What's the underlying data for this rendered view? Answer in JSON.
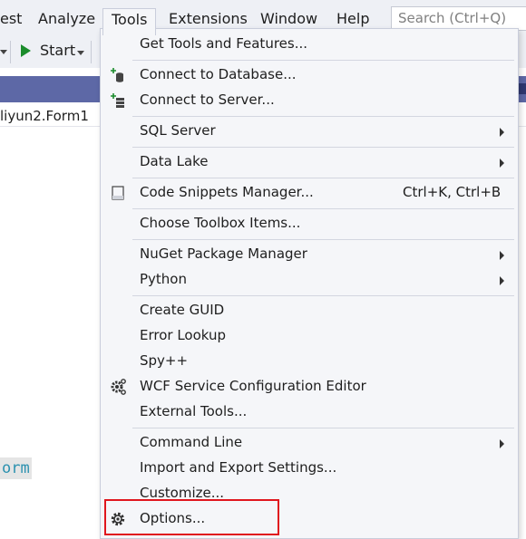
{
  "menubar": {
    "items": [
      {
        "label": "est"
      },
      {
        "label": "Analyze"
      },
      {
        "label": "Tools"
      },
      {
        "label": "Extensions"
      },
      {
        "label": "Window"
      },
      {
        "label": "Help"
      }
    ],
    "search_placeholder": "Search (Ctrl+Q)"
  },
  "toolbar": {
    "start_label": "Start"
  },
  "editor": {
    "breadcrumb": "liyun2.Form1",
    "code_token": "orm"
  },
  "tools_menu": {
    "items": [
      {
        "label": "Get Tools and Features...",
        "icon": "",
        "shortcut": "",
        "submenu": false
      },
      {
        "label": "Connect to Database...",
        "icon": "database-icon",
        "shortcut": "",
        "submenu": false
      },
      {
        "label": "Connect to Server...",
        "icon": "server-icon",
        "shortcut": "",
        "submenu": false
      },
      {
        "label": "SQL Server",
        "icon": "",
        "shortcut": "",
        "submenu": true
      },
      {
        "label": "Data Lake",
        "icon": "",
        "shortcut": "",
        "submenu": true
      },
      {
        "label": "Code Snippets Manager...",
        "icon": "snippet-icon",
        "shortcut": "Ctrl+K, Ctrl+B",
        "submenu": false
      },
      {
        "label": "Choose Toolbox Items...",
        "icon": "",
        "shortcut": "",
        "submenu": false
      },
      {
        "label": "NuGet Package Manager",
        "icon": "",
        "shortcut": "",
        "submenu": true
      },
      {
        "label": "Python",
        "icon": "",
        "shortcut": "",
        "submenu": true
      },
      {
        "label": "Create GUID",
        "icon": "",
        "shortcut": "",
        "submenu": false
      },
      {
        "label": "Error Lookup",
        "icon": "",
        "shortcut": "",
        "submenu": false
      },
      {
        "label": "Spy++",
        "icon": "",
        "shortcut": "",
        "submenu": false
      },
      {
        "label": "WCF Service Configuration Editor",
        "icon": "wcf-gear-icon",
        "shortcut": "",
        "submenu": false
      },
      {
        "label": "External Tools...",
        "icon": "",
        "shortcut": "",
        "submenu": false
      },
      {
        "label": "Command Line",
        "icon": "",
        "shortcut": "",
        "submenu": true
      },
      {
        "label": "Import and Export Settings...",
        "icon": "",
        "shortcut": "",
        "submenu": false
      },
      {
        "label": "Customize...",
        "icon": "",
        "shortcut": "",
        "submenu": false
      },
      {
        "label": "Options...",
        "icon": "gear-icon",
        "shortcut": "",
        "submenu": false
      }
    ]
  },
  "colors": {
    "annotation_box": "#e0161e",
    "menu_background": "#f5f6f9",
    "tab_strip": "#5d68a6",
    "start_play": "#1b8c2c",
    "code_token": "#2b91af"
  }
}
